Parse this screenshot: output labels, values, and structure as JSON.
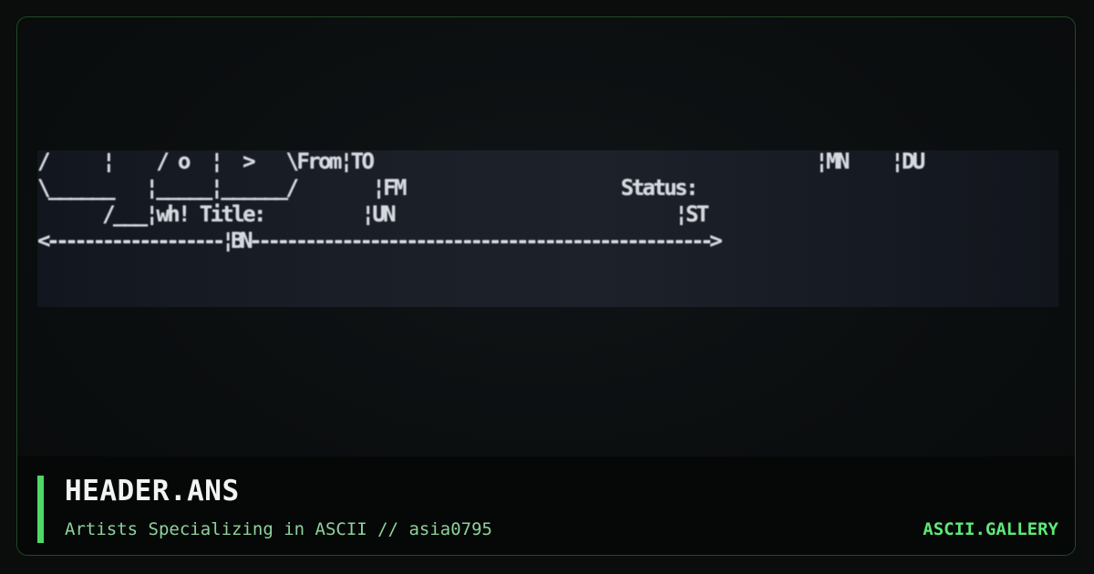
{
  "art": {
    "lines": [
      "/     ¦    / o  ¦  >   \\From¦TO                                         ¦MN    ¦DU",
      "\\______   ¦_____¦______/       ¦FM                    Status:",
      "      /___¦wh! Title:         ¦UN                          ¦ST",
      "<-------------------¦BN-------------------------------------------------->"
    ]
  },
  "footer": {
    "title": "HEADER.ANS",
    "subtitle": "Artists Specializing in ASCII // asia0795",
    "brand": "ASCII.GALLERY"
  },
  "colors": {
    "accent": "#4fd865",
    "brand": "#5ee877",
    "subtitle": "#8fd19a",
    "border": "#1f4a24"
  }
}
